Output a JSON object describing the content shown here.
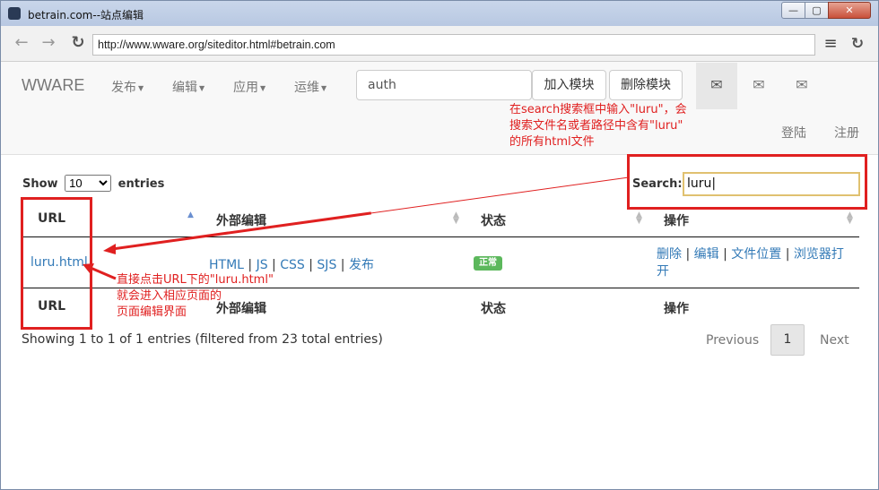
{
  "window": {
    "title": "betrain.com--站点编辑",
    "min": "—",
    "max": "▢",
    "close": "✕"
  },
  "browser": {
    "back": "←",
    "forward": "→",
    "reload": "↻",
    "url": "http://www.wware.org/siteditor.html#betrain.com",
    "menu": "≡",
    "reload_right": "↻"
  },
  "navbar": {
    "brand": "WWARE",
    "menus": [
      "发布",
      "编辑",
      "应用",
      "运维"
    ],
    "search_value": "auth",
    "btn_add": "加入模块",
    "btn_delete": "删除模块",
    "mail_icon": "✉",
    "login": "登陆",
    "register": "注册"
  },
  "annotations": {
    "search_note": [
      "在search搜索框中输入\"luru\"，会",
      "搜索文件名或者路径中含有\"luru\"",
      "的所有html文件"
    ],
    "url_note": [
      "直接点击URL下的\"luru.html\"",
      "就会进入相应页面的",
      "页面编辑界面"
    ]
  },
  "table": {
    "show_label": "Show",
    "entries_value": "10",
    "entries_label": "entries",
    "search_label": "Search:",
    "search_value": "luru",
    "headers": [
      "URL",
      "外部编辑",
      "状态",
      "操作"
    ],
    "row": {
      "url": "luru.html",
      "edit_links": [
        "HTML",
        "JS",
        "CSS",
        "SJS",
        "发布"
      ],
      "status": "正常",
      "actions": [
        "删除",
        "编辑",
        "文件位置",
        "浏览器打开"
      ]
    },
    "info": "Showing 1 to 1 of 1 entries (filtered from 23 total entries)",
    "pagination": {
      "previous": "Previous",
      "page": "1",
      "next": "Next"
    }
  },
  "colors": {
    "annotation_red": "#e02020",
    "link_blue": "#337ab7",
    "badge_green": "#5cb85c"
  }
}
